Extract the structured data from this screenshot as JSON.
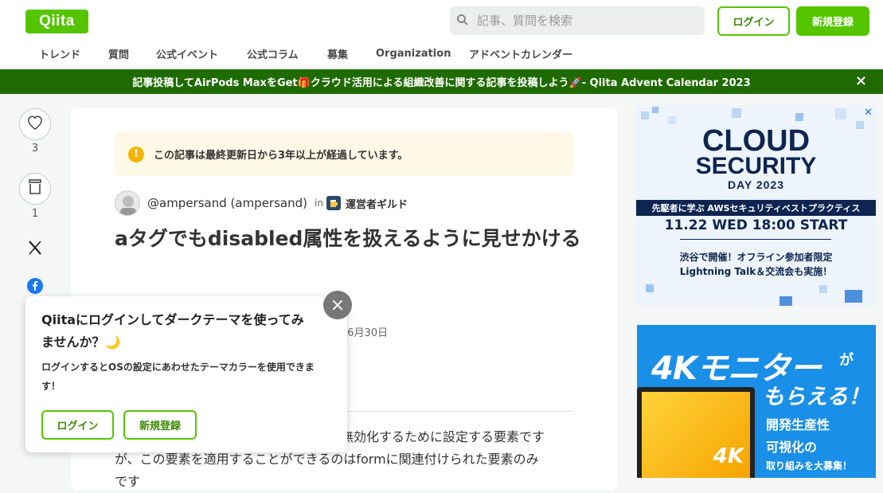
{
  "header": {
    "logo": "Qiita",
    "search_placeholder": "記事、質問を検索",
    "login_label": "ログイン",
    "signup_label": "新規登録"
  },
  "nav": {
    "items": [
      "トレンド",
      "質問",
      "公式イベント",
      "公式コラム",
      "募集",
      "Organization",
      "アドベントカレンダー"
    ]
  },
  "banner": {
    "text": "記事投稿してAirPods MaxをGet🎁クラウド活用による組織改善に関する記事を投稿しよう🚀- Qiita Advent Calendar 2023",
    "close": "×"
  },
  "side": {
    "like_count": "3",
    "stock_count": "1",
    "x_icon": "X"
  },
  "article": {
    "notice": "この記事は最終更新日から3年以上が経過しています。",
    "author": "@ampersand (ampersand)",
    "in_label": "in",
    "org": "運営者ギルド",
    "title": "aタグでもdisabled属性を扱えるように見せかける",
    "date": "06月30日",
    "body_line1": "無効化するために設定する要素です",
    "body_line2": "が、この要素を適用することができるのはformに関連付けられた要素のみ",
    "body_line3": "です"
  },
  "popup": {
    "title": "Qiitaにログインしてダークテーマを使ってみませんか？🌙",
    "text": "ログインするとOSの設定にあわせたテーマカラーを使用できます！",
    "login_label": "ログイン",
    "signup_label": "新規登録",
    "close": "×"
  },
  "ad_cloud": {
    "close": "✕",
    "line1": "CLOUD",
    "line2": "SECURITY",
    "line3": "DAY 2023",
    "subtitle": "先駆者に学ぶ AWSセキュリティベストプラクティス",
    "date": "11.22 WED 18:00 START",
    "note1": "渋谷で開催！オフライン参加者限定",
    "note2": "Lightning Talk＆交流会も実施！"
  },
  "ad_monitor": {
    "headline": "4Kモニター",
    "ga": "が",
    "sub": "もらえる！",
    "screen_label": "4K",
    "feature1": "開発生産性",
    "feature2": "可視化の",
    "feature3": "取り組みを大募集！"
  },
  "colors": {
    "brand_green": "#55c500",
    "banner_green": "#1f6b02",
    "notice_bg": "#fef9e6"
  }
}
